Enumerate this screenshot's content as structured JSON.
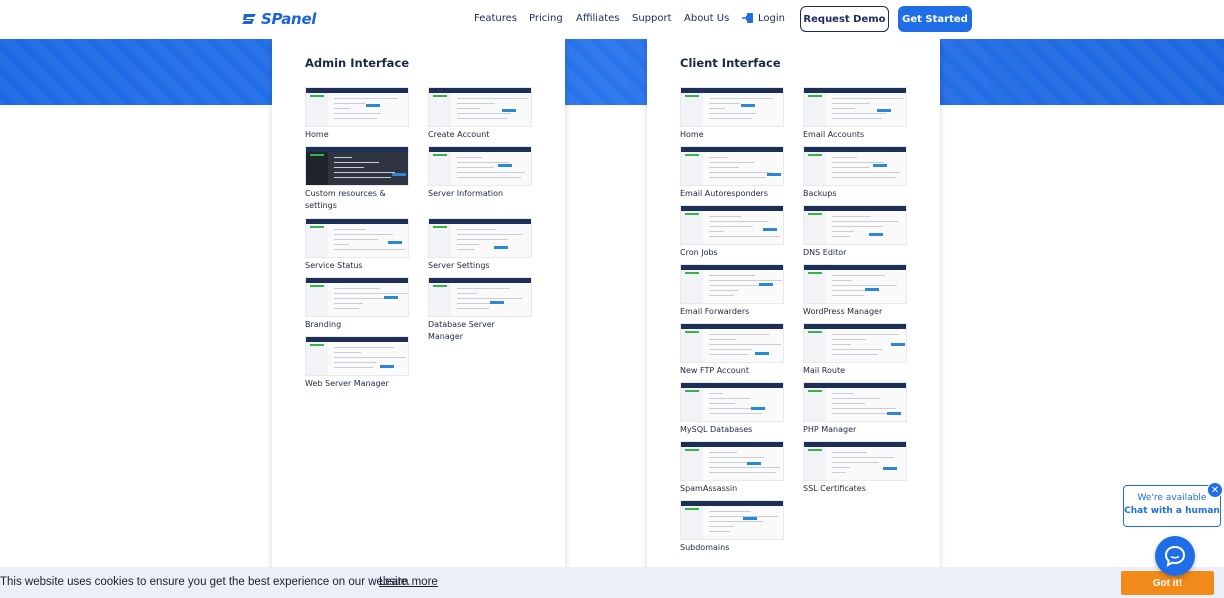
{
  "brand": {
    "name": "SPanel",
    "accent": "#1f6ee8",
    "navy": "#1d2a5e"
  },
  "nav": {
    "items": [
      "Features",
      "Pricing",
      "Affiliates",
      "Support",
      "About Us"
    ],
    "login": "Login",
    "request_demo": "Request Demo",
    "get_started": "Get Started"
  },
  "admin": {
    "title": "Admin Interface",
    "items": [
      "Home",
      "Create Account",
      "Custom resources & settings",
      "Server Information",
      "Service Status",
      "Server Settings",
      "Branding",
      "Database Server Manager",
      "Web Server Manager"
    ]
  },
  "client": {
    "title": "Client Interface",
    "items": [
      "Home",
      "Email Accounts",
      "Email Autoresponders",
      "Backups",
      "Cron Jobs",
      "DNS Editor",
      "Email Forwarders",
      "WordPress Manager",
      "New FTP Account",
      "Mail Route",
      "MySQL Databases",
      "PHP Manager",
      "SpamAssassin",
      "SSL Certificates",
      "Subdomains"
    ]
  },
  "cookie": {
    "message": "This website uses cookies to ensure you get the best experience on our website.",
    "link": "Learn more",
    "button": "Got it!",
    "button_color": "#f28a1a"
  },
  "chat": {
    "line1": "We're available",
    "line2": "Chat with a human",
    "icons": [
      "close-icon",
      "chat-icon"
    ]
  }
}
